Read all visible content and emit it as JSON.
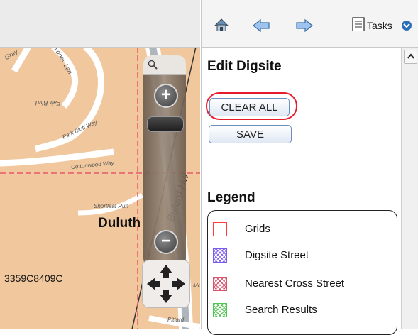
{
  "map": {
    "streets": {
      "gray": "Gray",
      "sydney_lane": "Sydney Lan",
      "fair_blvd": "Fair Blvd",
      "park_bluff_way": "Park Bluff Way",
      "cottonwood_way": "Cottonwood Way",
      "shortleaf_run": "Shortleaf Run",
      "buford_hwy": "Buford Hw",
      "pittard": "Pittard",
      "mc": "Mc"
    },
    "city": "Duluth",
    "grid_id": "3359C8409C",
    "zoom": {
      "search_icon": "magnifier-icon",
      "zoom_in_icon": "plus-icon",
      "zoom_out_icon": "minus-icon",
      "zoom_in_label": "+",
      "zoom_out_label": "−"
    }
  },
  "toolbar": {
    "home_icon": "home-icon",
    "back_icon": "left-arrow-icon",
    "forward_icon": "right-arrow-icon",
    "tasks_icon": "document-icon",
    "tasks_label": "Tasks",
    "tasks_dropdown_icon": "chevron-down-circle-icon"
  },
  "panel": {
    "title": "Edit Digsite",
    "clear_all_label": "CLEAR ALL",
    "save_label": "SAVE",
    "legend_title": "Legend",
    "legend_items": [
      {
        "label": "Grids",
        "color": "#ff3b3b",
        "pattern": "solid"
      },
      {
        "label": "Digsite Street",
        "color": "#7a5cf2",
        "pattern": "hatch"
      },
      {
        "label": "Nearest Cross Street",
        "color": "#d9566c",
        "pattern": "hatch"
      },
      {
        "label": "Search Results",
        "color": "#52c452",
        "pattern": "hatch"
      }
    ]
  },
  "colors": {
    "map_bg": "#f1c79e",
    "highlight_ring": "#e81b2c",
    "button_border": "#6d8fbd"
  }
}
